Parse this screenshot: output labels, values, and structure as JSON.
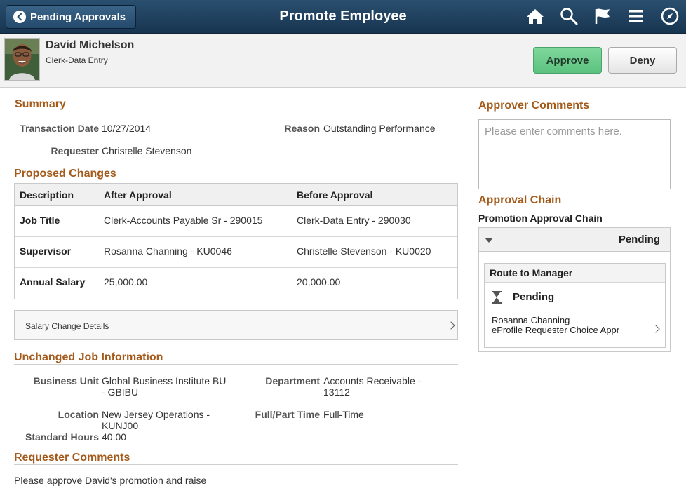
{
  "nav": {
    "back_label": "Pending Approvals",
    "title": "Promote Employee",
    "icons": [
      "home-icon",
      "search-icon",
      "flag-icon",
      "menu-icon",
      "compass-icon"
    ]
  },
  "employee": {
    "name": "David Michelson",
    "role": "Clerk-Data Entry"
  },
  "actions": {
    "approve": "Approve",
    "deny": "Deny"
  },
  "summary": {
    "heading": "Summary",
    "transaction_date_label": "Transaction Date",
    "transaction_date": "10/27/2014",
    "reason_label": "Reason",
    "reason": "Outstanding Performance",
    "requester_label": "Requester",
    "requester": "Christelle Stevenson"
  },
  "proposed": {
    "heading": "Proposed Changes",
    "columns": [
      "Description",
      "After Approval",
      "Before Approval"
    ],
    "rows": [
      {
        "desc": "Job Title",
        "after": "Clerk-Accounts Payable Sr - 290015",
        "before": "Clerk-Data Entry - 290030"
      },
      {
        "desc": "Supervisor",
        "after": "Rosanna Channing - KU0046",
        "before": "Christelle Stevenson - KU0020"
      },
      {
        "desc": "Annual Salary",
        "after": "25,000.00",
        "before": "20,000.00"
      }
    ],
    "salary_details": "Salary Change Details"
  },
  "unchanged": {
    "heading": "Unchanged Job Information",
    "business_unit_label": "Business Unit",
    "business_unit_l1": "Global Business Institute BU",
    "business_unit_l2": "- GBIBU",
    "department_label": "Department",
    "department_l1": "Accounts Receivable -",
    "department_l2": "13112",
    "location_label": "Location",
    "location_l1": "New Jersey Operations -",
    "location_l2": "KUNJ00",
    "fullpart_label": "Full/Part Time",
    "fullpart": "Full-Time",
    "std_hours_label": "Standard Hours",
    "std_hours": "40.00"
  },
  "requester_comments": {
    "heading": "Requester Comments",
    "text": "Please approve David's promotion and raise"
  },
  "approver": {
    "heading": "Approver Comments",
    "placeholder": "Please enter comments here."
  },
  "chain": {
    "heading": "Approval Chain",
    "name": "Promotion Approval Chain",
    "status": "Pending",
    "route_title": "Route to Manager",
    "route_status": "Pending",
    "approver_name": "Rosanna Channing",
    "approver_role": "eProfile Requester Choice Appr"
  }
}
